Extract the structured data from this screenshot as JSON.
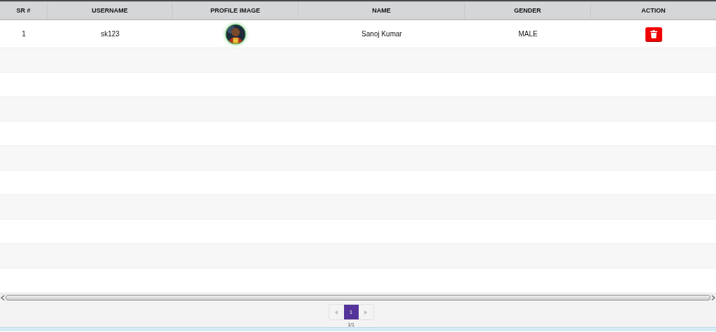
{
  "table": {
    "columns": [
      "SR #",
      "USERNAME",
      "PROFILE IMAGE",
      "NAME",
      "GENDER",
      "ACTION"
    ],
    "rows": [
      {
        "sr": "1",
        "username": "sk123",
        "name": "Sanoj Kumar",
        "gender": "MALE",
        "action": {
          "kind": "delete"
        }
      }
    ]
  },
  "pagination": {
    "pages": [
      {
        "label": "1",
        "selected": true
      }
    ],
    "summary": "1/1"
  }
}
